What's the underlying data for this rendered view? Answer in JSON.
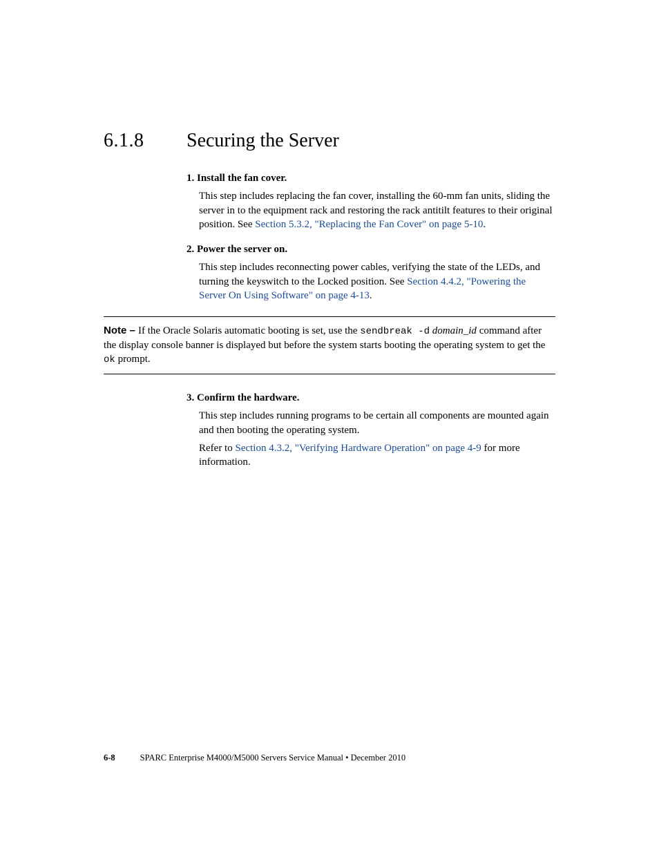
{
  "heading": {
    "number": "6.1.8",
    "title": "Securing the Server"
  },
  "steps": {
    "s1": {
      "num": "1.",
      "title": "Install the fan cover.",
      "para_a": "This step includes replacing the fan cover, installing the 60-mm fan units, sliding the server in to the equipment rack and restoring the rack antitilt features to their original position. See ",
      "link": "Section 5.3.2, \"Replacing the Fan Cover\" on page 5-10",
      "para_b": "."
    },
    "s2": {
      "num": "2.",
      "title": "Power the server on.",
      "para_a": "This step includes reconnecting power cables, verifying the state of the LEDs, and turning the keyswitch to the Locked position. See ",
      "link": "Section 4.4.2, \"Powering the Server On Using Software\" on page 4-13",
      "para_b": "."
    },
    "s3": {
      "num": "3.",
      "title": "Confirm the hardware.",
      "para_a": "This step includes running programs to be certain all components are mounted again and then booting the operating system.",
      "para_b_pre": "Refer to ",
      "link": "Section 4.3.2, \"Verifying Hardware Operation\" on page 4-9",
      "para_b_post": " for more information."
    }
  },
  "note": {
    "label": "Note – ",
    "pre_cmd": "If the Oracle Solaris automatic booting is set, use the ",
    "cmd": "sendbreak -d",
    "post_cmd_a": " ",
    "italic": "domain_id",
    "post_cmd_b": " command after the display console banner is displayed but before the system starts booting the operating system to get the ",
    "ok": "ok",
    "post_ok": " prompt."
  },
  "footer": {
    "page": "6-8",
    "text": "SPARC Enterprise M4000/M5000 Servers Service Manual  •  December 2010"
  }
}
